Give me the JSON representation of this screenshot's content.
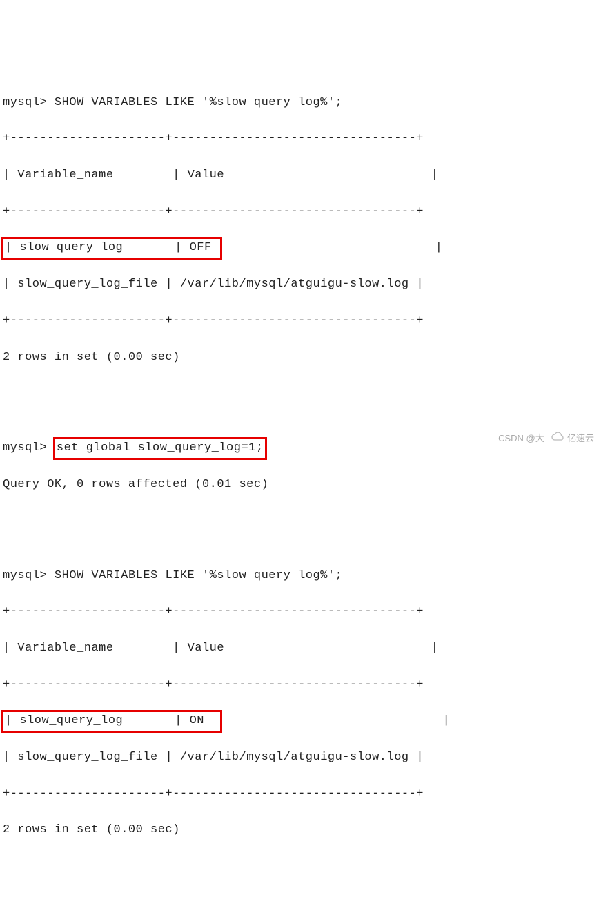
{
  "prompt": "mysql>",
  "queries": {
    "q1": {
      "command": "SHOW VARIABLES LIKE '%slow_query_log%';",
      "header": {
        "col1": "Variable_name",
        "col2": "Value"
      },
      "rows": {
        "r1": {
          "col1": "slow_query_log",
          "col2": "OFF"
        },
        "r2": {
          "col1": "slow_query_log_file",
          "col2": "/var/lib/mysql/atguigu-slow.log"
        }
      },
      "footer": "2 rows in set (0.00 sec)"
    },
    "q2": {
      "command": "set global slow_query_log=1;",
      "result": "Query OK, 0 rows affected (0.01 sec)"
    },
    "q3": {
      "command": "SHOW VARIABLES LIKE '%slow_query_log%';",
      "header": {
        "col1": "Variable_name",
        "col2": "Value"
      },
      "rows": {
        "r1": {
          "col1": "slow_query_log",
          "col2": "ON"
        },
        "r2": {
          "col1": "slow_query_log_file",
          "col2": "/var/lib/mysql/atguigu-slow.log"
        }
      },
      "footer": "2 rows in set (0.00 sec)"
    }
  },
  "watermark": {
    "csdn": "CSDN @大",
    "yisu": "亿速云"
  },
  "separators": {
    "top": "+---------------------+---------------------------------+",
    "pipe": "|",
    "pad20": "       ",
    "pad6": "      ",
    "padval": "                           ",
    "padoff": "                             ",
    "padon": "                              "
  }
}
